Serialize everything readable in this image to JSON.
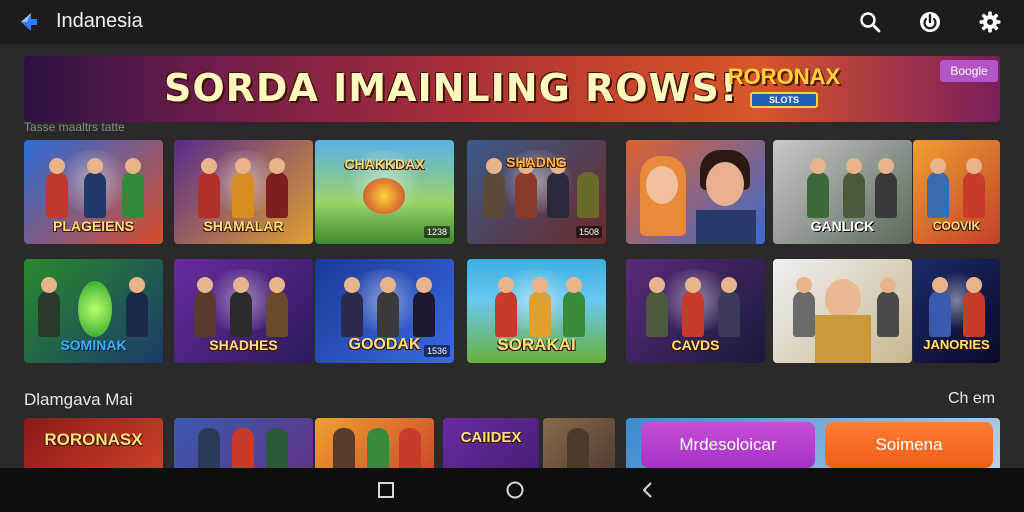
{
  "header": {
    "title": "Indanesia",
    "back_icon": "back-arrow-icon",
    "icons": [
      "search-icon",
      "power-icon",
      "gear-icon"
    ]
  },
  "banner": {
    "headline": "SORDA IMAINLING ROWS!",
    "logo_text": "RORONAX",
    "logo_sub": "SLOTS",
    "button_label": "Boogle"
  },
  "strip_label": "Tasse maaltrs tatte",
  "row1": [
    {
      "caption": "PLAGEIENS",
      "tag": ""
    },
    {
      "caption": "SHAMALAR",
      "tag": ""
    },
    {
      "caption": "CHAKKDAX",
      "tag": "1238"
    },
    {
      "caption": "SHADNG",
      "tag": "1508"
    },
    {
      "caption": "",
      "tag": ""
    },
    {
      "caption": "GANLICK",
      "tag": ""
    },
    {
      "caption": "COOVIK",
      "tag": ""
    }
  ],
  "row2": [
    {
      "caption": "SOMINAK",
      "tag": ""
    },
    {
      "caption": "SHADHES",
      "tag": ""
    },
    {
      "caption": "GOODAK",
      "tag": "1536"
    },
    {
      "caption": "SORAKAI",
      "tag": ""
    },
    {
      "caption": "CAVDS",
      "tag": ""
    },
    {
      "caption": "",
      "tag": ""
    },
    {
      "caption": "JANORIES",
      "tag": ""
    }
  ],
  "row3": [
    {
      "caption": "RORONASX"
    },
    {
      "caption": ""
    },
    {
      "caption": ""
    },
    {
      "caption": "CAIIDEX"
    },
    {
      "caption": ""
    },
    {
      "caption": ""
    }
  ],
  "section": {
    "title": "Dlamgava Mai",
    "more": "Ch em"
  },
  "buttons": {
    "more_label": "Mrdesoloicar",
    "main_label": "Soimena"
  },
  "colors": {
    "accent_purple": "#b245c8",
    "accent_orange": "#f26a22",
    "background": "#2a2a2a",
    "topbar": "#1c1c1c"
  }
}
